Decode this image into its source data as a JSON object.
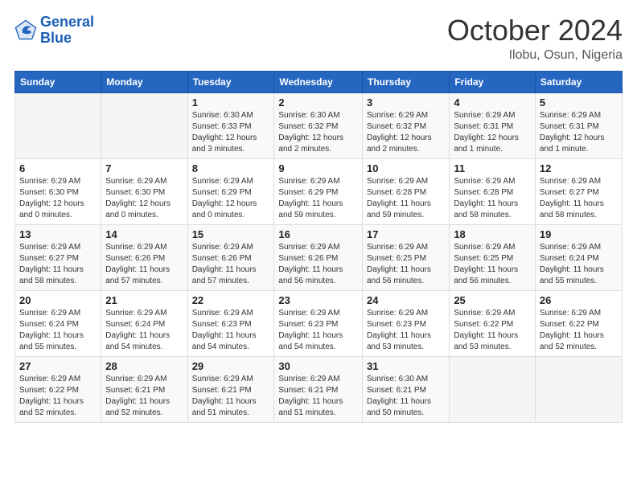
{
  "logo": {
    "line1": "General",
    "line2": "Blue"
  },
  "title": "October 2024",
  "location": "Ilobu, Osun, Nigeria",
  "days_of_week": [
    "Sunday",
    "Monday",
    "Tuesday",
    "Wednesday",
    "Thursday",
    "Friday",
    "Saturday"
  ],
  "weeks": [
    [
      {
        "day": "",
        "info": ""
      },
      {
        "day": "",
        "info": ""
      },
      {
        "day": "1",
        "info": "Sunrise: 6:30 AM\nSunset: 6:33 PM\nDaylight: 12 hours and 3 minutes."
      },
      {
        "day": "2",
        "info": "Sunrise: 6:30 AM\nSunset: 6:32 PM\nDaylight: 12 hours and 2 minutes."
      },
      {
        "day": "3",
        "info": "Sunrise: 6:29 AM\nSunset: 6:32 PM\nDaylight: 12 hours and 2 minutes."
      },
      {
        "day": "4",
        "info": "Sunrise: 6:29 AM\nSunset: 6:31 PM\nDaylight: 12 hours and 1 minute."
      },
      {
        "day": "5",
        "info": "Sunrise: 6:29 AM\nSunset: 6:31 PM\nDaylight: 12 hours and 1 minute."
      }
    ],
    [
      {
        "day": "6",
        "info": "Sunrise: 6:29 AM\nSunset: 6:30 PM\nDaylight: 12 hours and 0 minutes."
      },
      {
        "day": "7",
        "info": "Sunrise: 6:29 AM\nSunset: 6:30 PM\nDaylight: 12 hours and 0 minutes."
      },
      {
        "day": "8",
        "info": "Sunrise: 6:29 AM\nSunset: 6:29 PM\nDaylight: 12 hours and 0 minutes."
      },
      {
        "day": "9",
        "info": "Sunrise: 6:29 AM\nSunset: 6:29 PM\nDaylight: 11 hours and 59 minutes."
      },
      {
        "day": "10",
        "info": "Sunrise: 6:29 AM\nSunset: 6:28 PM\nDaylight: 11 hours and 59 minutes."
      },
      {
        "day": "11",
        "info": "Sunrise: 6:29 AM\nSunset: 6:28 PM\nDaylight: 11 hours and 58 minutes."
      },
      {
        "day": "12",
        "info": "Sunrise: 6:29 AM\nSunset: 6:27 PM\nDaylight: 11 hours and 58 minutes."
      }
    ],
    [
      {
        "day": "13",
        "info": "Sunrise: 6:29 AM\nSunset: 6:27 PM\nDaylight: 11 hours and 58 minutes."
      },
      {
        "day": "14",
        "info": "Sunrise: 6:29 AM\nSunset: 6:26 PM\nDaylight: 11 hours and 57 minutes."
      },
      {
        "day": "15",
        "info": "Sunrise: 6:29 AM\nSunset: 6:26 PM\nDaylight: 11 hours and 57 minutes."
      },
      {
        "day": "16",
        "info": "Sunrise: 6:29 AM\nSunset: 6:26 PM\nDaylight: 11 hours and 56 minutes."
      },
      {
        "day": "17",
        "info": "Sunrise: 6:29 AM\nSunset: 6:25 PM\nDaylight: 11 hours and 56 minutes."
      },
      {
        "day": "18",
        "info": "Sunrise: 6:29 AM\nSunset: 6:25 PM\nDaylight: 11 hours and 56 minutes."
      },
      {
        "day": "19",
        "info": "Sunrise: 6:29 AM\nSunset: 6:24 PM\nDaylight: 11 hours and 55 minutes."
      }
    ],
    [
      {
        "day": "20",
        "info": "Sunrise: 6:29 AM\nSunset: 6:24 PM\nDaylight: 11 hours and 55 minutes."
      },
      {
        "day": "21",
        "info": "Sunrise: 6:29 AM\nSunset: 6:24 PM\nDaylight: 11 hours and 54 minutes."
      },
      {
        "day": "22",
        "info": "Sunrise: 6:29 AM\nSunset: 6:23 PM\nDaylight: 11 hours and 54 minutes."
      },
      {
        "day": "23",
        "info": "Sunrise: 6:29 AM\nSunset: 6:23 PM\nDaylight: 11 hours and 54 minutes."
      },
      {
        "day": "24",
        "info": "Sunrise: 6:29 AM\nSunset: 6:23 PM\nDaylight: 11 hours and 53 minutes."
      },
      {
        "day": "25",
        "info": "Sunrise: 6:29 AM\nSunset: 6:22 PM\nDaylight: 11 hours and 53 minutes."
      },
      {
        "day": "26",
        "info": "Sunrise: 6:29 AM\nSunset: 6:22 PM\nDaylight: 11 hours and 52 minutes."
      }
    ],
    [
      {
        "day": "27",
        "info": "Sunrise: 6:29 AM\nSunset: 6:22 PM\nDaylight: 11 hours and 52 minutes."
      },
      {
        "day": "28",
        "info": "Sunrise: 6:29 AM\nSunset: 6:21 PM\nDaylight: 11 hours and 52 minutes."
      },
      {
        "day": "29",
        "info": "Sunrise: 6:29 AM\nSunset: 6:21 PM\nDaylight: 11 hours and 51 minutes."
      },
      {
        "day": "30",
        "info": "Sunrise: 6:29 AM\nSunset: 6:21 PM\nDaylight: 11 hours and 51 minutes."
      },
      {
        "day": "31",
        "info": "Sunrise: 6:30 AM\nSunset: 6:21 PM\nDaylight: 11 hours and 50 minutes."
      },
      {
        "day": "",
        "info": ""
      },
      {
        "day": "",
        "info": ""
      }
    ]
  ]
}
